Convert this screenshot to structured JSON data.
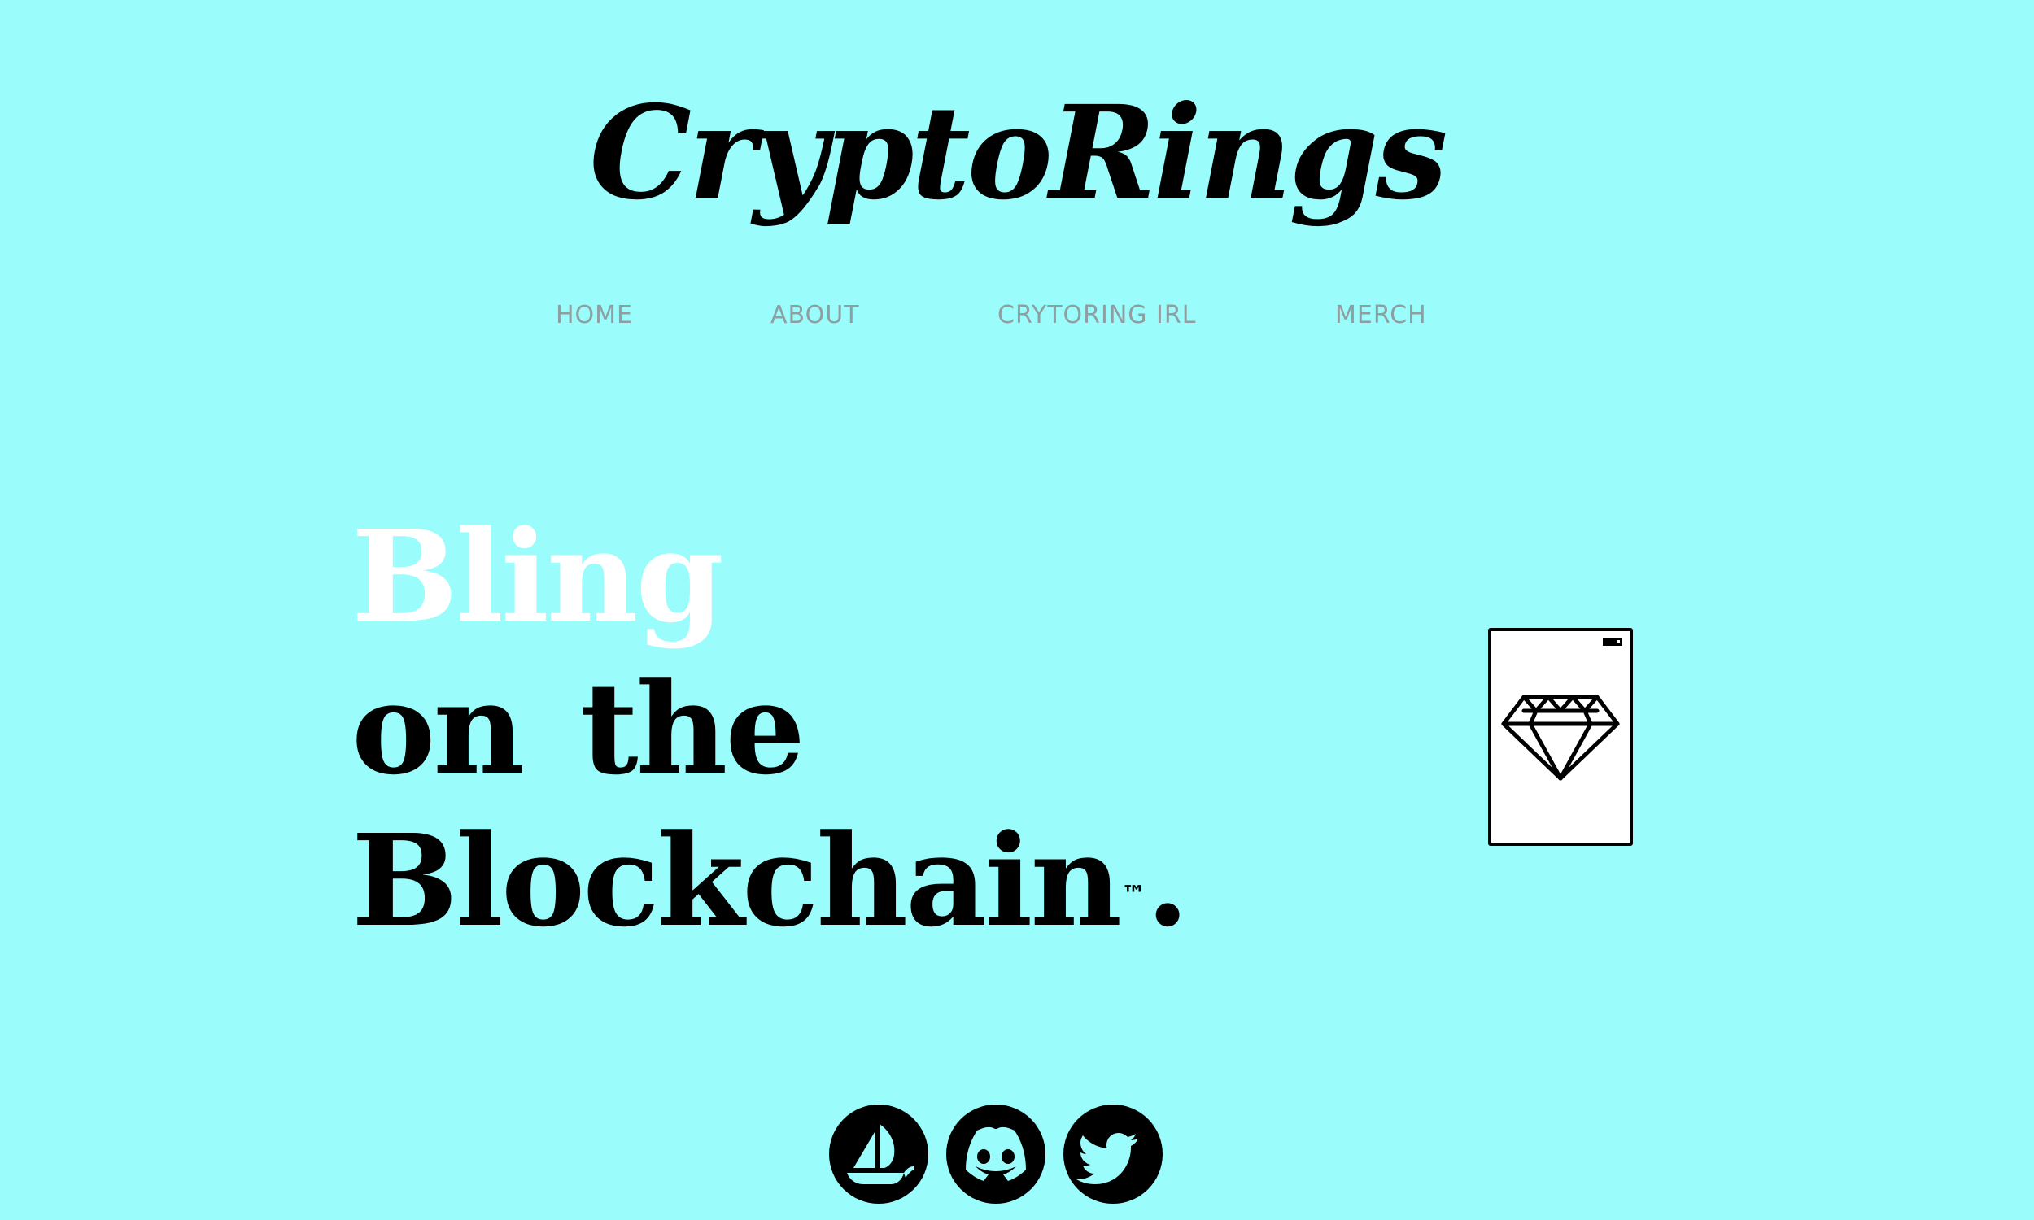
{
  "site": {
    "logo_text": "CryptoRings"
  },
  "nav": {
    "items": [
      {
        "label": "HOME"
      },
      {
        "label": "ABOUT"
      },
      {
        "label": "CRYTORING IRL"
      },
      {
        "label": "MERCH"
      }
    ]
  },
  "hero": {
    "line1": "Bling",
    "line2": "on the",
    "line3": "Blockchain",
    "trademark": "™",
    "period": "."
  },
  "card": {
    "icon": "diamond-icon"
  },
  "socials": [
    {
      "icon": "opensea-icon"
    },
    {
      "icon": "discord-icon"
    },
    {
      "icon": "twitter-icon"
    }
  ],
  "colors": {
    "background": "#9bfcfc",
    "nav_text": "#8f9ea1",
    "hero_highlight": "#ffffff",
    "text": "#000000"
  }
}
